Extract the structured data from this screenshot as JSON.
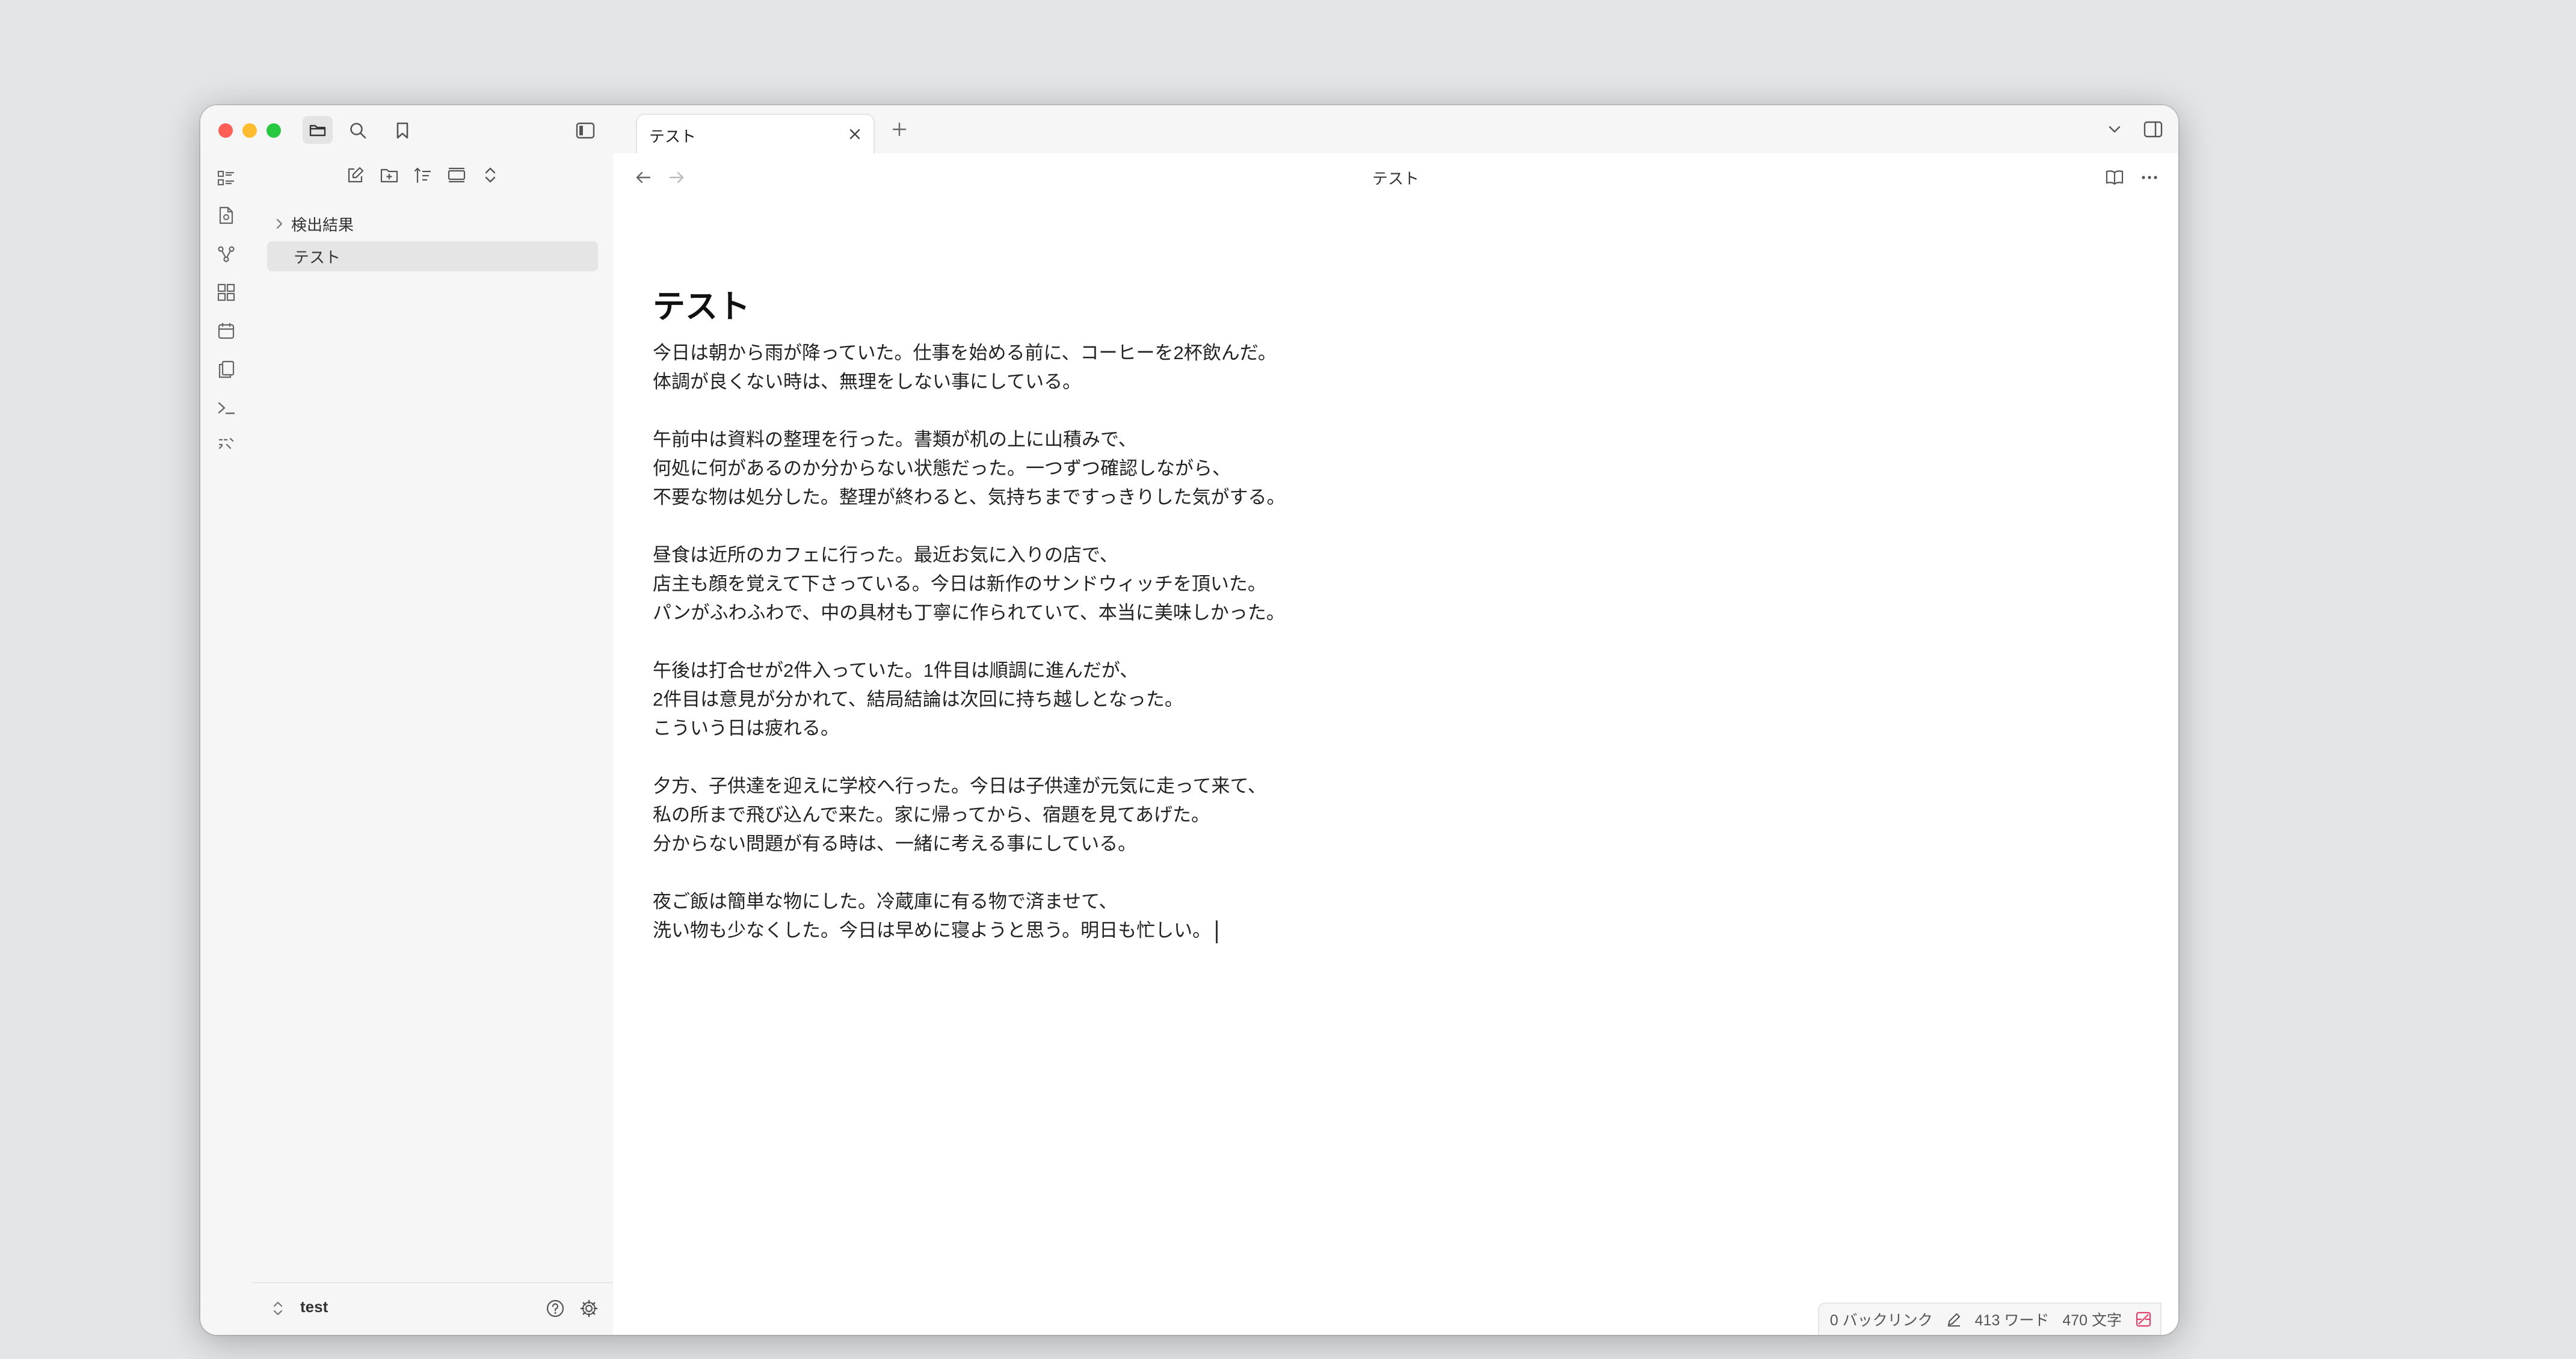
{
  "sidebar": {
    "tree": [
      {
        "label": "検出結果",
        "type": "folder",
        "collapsed": true
      },
      {
        "label": "テスト",
        "type": "file",
        "active": true
      }
    ],
    "vault_name": "test"
  },
  "tabs": [
    {
      "label": "テスト",
      "active": true
    }
  ],
  "view": {
    "title": "テスト"
  },
  "note": {
    "heading": "テスト",
    "lines": [
      "今日は朝から雨が降っていた。仕事を始める前に、コーヒーを2杯飲んだ。",
      "体調が良くない時は、無理をしない事にしている。",
      "",
      "午前中は資料の整理を行った。書類が机の上に山積みで、",
      "何処に何があるのか分からない状態だった。一つずつ確認しながら、",
      "不要な物は処分した。整理が終わると、気持ちまですっきりした気がする。",
      "",
      "昼食は近所のカフェに行った。最近お気に入りの店で、",
      "店主も顔を覚えて下さっている。今日は新作のサンドウィッチを頂いた。",
      "パンがふわふわで、中の具材も丁寧に作られていて、本当に美味しかった。",
      "",
      "午後は打合せが2件入っていた。1件目は順調に進んだが、",
      "2件目は意見が分かれて、結局結論は次回に持ち越しとなった。",
      "こういう日は疲れる。",
      "",
      "夕方、子供達を迎えに学校へ行った。今日は子供達が元気に走って来て、",
      "私の所まで飛び込んで来た。家に帰ってから、宿題を見てあげた。",
      "分からない問題が有る時は、一緒に考える事にしている。",
      "",
      "夜ご飯は簡単な物にした。冷蔵庫に有る物で済ませて、",
      "洗い物も少なくした。今日は早めに寝ようと思う。明日も忙しい。"
    ]
  },
  "status": {
    "backlinks": "0 バックリンク",
    "words": "413 ワード",
    "chars": "470 文字"
  },
  "colors": {
    "traffic_close": "#ff5f57",
    "traffic_minimize": "#febc2e",
    "traffic_zoom": "#28c840",
    "sidebar_bg": "#f6f6f6"
  }
}
